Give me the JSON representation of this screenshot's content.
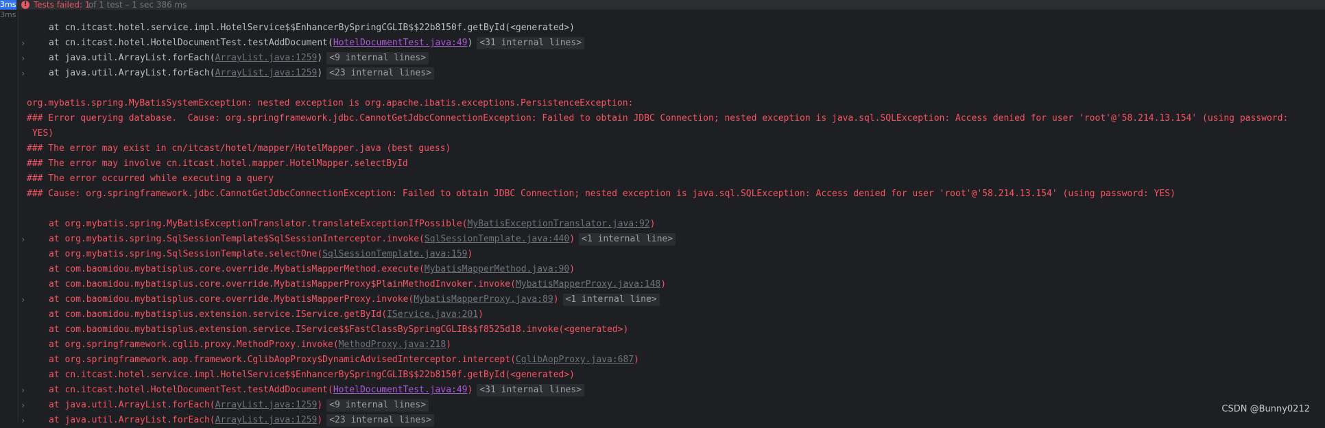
{
  "header": {
    "time_badge": "3ms",
    "status_icon": "error-icon",
    "status_icon_glyph": "!",
    "fail_label": "Tests failed: 1",
    "fail_rest": " of 1 test – 1 sec 386 ms"
  },
  "gutter": {
    "time": "3ms"
  },
  "colors": {
    "error": "#f75464",
    "link": "#a95cd6",
    "dim": "#6f737a",
    "text": "#bcbec4"
  },
  "lines": [
    {
      "frame": true,
      "text": "at cn.itcast.hotel.service.impl.HotelService$$EnhancerBySpringCGLIB$$22b8150f.getById(<generated>)"
    },
    {
      "frame": true,
      "chev": true,
      "text": "at cn.itcast.hotel.HotelDocumentTest.testAddDocument(",
      "link": "HotelDocumentTest.java:49",
      "link_dim": false,
      "close": ")",
      "badge": "<31 internal lines>"
    },
    {
      "frame": true,
      "chev": true,
      "text": "at java.util.ArrayList.forEach(",
      "link": "ArrayList.java:1259",
      "link_dim": true,
      "close": ")",
      "badge": "<9 internal lines>"
    },
    {
      "frame": true,
      "chev": true,
      "text": "at java.util.ArrayList.forEach(",
      "link": "ArrayList.java:1259",
      "link_dim": true,
      "close": ")",
      "badge": "<23 internal lines>"
    },
    {
      "text": ""
    },
    {
      "err": true,
      "text": "org.mybatis.spring.MyBatisSystemException: nested exception is org.apache.ibatis.exceptions.PersistenceException:"
    },
    {
      "err": true,
      "text": "### Error querying database.  Cause: org.springframework.jdbc.CannotGetJdbcConnectionException: Failed to obtain JDBC Connection; nested exception is java.sql.SQLException: Access denied for user 'root'@'58.214.13.154' (using password:"
    },
    {
      "err": true,
      "text": " YES)"
    },
    {
      "err": true,
      "text": "### The error may exist in cn/itcast/hotel/mapper/HotelMapper.java (best guess)"
    },
    {
      "err": true,
      "text": "### The error may involve cn.itcast.hotel.mapper.HotelMapper.selectById"
    },
    {
      "err": true,
      "text": "### The error occurred while executing a query"
    },
    {
      "err": true,
      "text": "### Cause: org.springframework.jdbc.CannotGetJdbcConnectionException: Failed to obtain JDBC Connection; nested exception is java.sql.SQLException: Access denied for user 'root'@'58.214.13.154' (using password: YES)"
    },
    {
      "text": ""
    },
    {
      "err": true,
      "frame": true,
      "text": "at org.mybatis.spring.MyBatisExceptionTranslator.translateExceptionIfPossible(",
      "link": "MyBatisExceptionTranslator.java:92",
      "link_dim": true,
      "close": ")"
    },
    {
      "err": true,
      "frame": true,
      "chev": true,
      "text": "at org.mybatis.spring.SqlSessionTemplate$SqlSessionInterceptor.invoke(",
      "link": "SqlSessionTemplate.java:440",
      "link_dim": true,
      "close": ")",
      "badge": "<1 internal line>"
    },
    {
      "err": true,
      "frame": true,
      "text": "at org.mybatis.spring.SqlSessionTemplate.selectOne(",
      "link": "SqlSessionTemplate.java:159",
      "link_dim": true,
      "close": ")"
    },
    {
      "err": true,
      "frame": true,
      "text": "at com.baomidou.mybatisplus.core.override.MybatisMapperMethod.execute(",
      "link": "MybatisMapperMethod.java:90",
      "link_dim": true,
      "close": ")"
    },
    {
      "err": true,
      "frame": true,
      "text": "at com.baomidou.mybatisplus.core.override.MybatisMapperProxy$PlainMethodInvoker.invoke(",
      "link": "MybatisMapperProxy.java:148",
      "link_dim": true,
      "close": ")"
    },
    {
      "err": true,
      "frame": true,
      "chev": true,
      "text": "at com.baomidou.mybatisplus.core.override.MybatisMapperProxy.invoke(",
      "link": "MybatisMapperProxy.java:89",
      "link_dim": true,
      "close": ")",
      "badge": "<1 internal line>"
    },
    {
      "err": true,
      "frame": true,
      "text": "at com.baomidou.mybatisplus.extension.service.IService.getById(",
      "link": "IService.java:201",
      "link_dim": true,
      "close": ")"
    },
    {
      "err": true,
      "frame": true,
      "text": "at com.baomidou.mybatisplus.extension.service.IService$$FastClassBySpringCGLIB$$f8525d18.invoke(<generated>)"
    },
    {
      "err": true,
      "frame": true,
      "text": "at org.springframework.cglib.proxy.MethodProxy.invoke(",
      "link": "MethodProxy.java:218",
      "link_dim": true,
      "close": ")"
    },
    {
      "err": true,
      "frame": true,
      "text": "at org.springframework.aop.framework.CglibAopProxy$DynamicAdvisedInterceptor.intercept(",
      "link": "CglibAopProxy.java:687",
      "link_dim": true,
      "close": ")"
    },
    {
      "err": true,
      "frame": true,
      "text": "at cn.itcast.hotel.service.impl.HotelService$$EnhancerBySpringCGLIB$$22b8150f.getById(<generated>)"
    },
    {
      "err": true,
      "frame": true,
      "chev": true,
      "text": "at cn.itcast.hotel.HotelDocumentTest.testAddDocument(",
      "link": "HotelDocumentTest.java:49",
      "link_dim": false,
      "close": ")",
      "badge": "<31 internal lines>"
    },
    {
      "err": true,
      "frame": true,
      "chev": true,
      "text": "at java.util.ArrayList.forEach(",
      "link": "ArrayList.java:1259",
      "link_dim": true,
      "close": ")",
      "badge": "<9 internal lines>"
    },
    {
      "err": true,
      "frame": true,
      "chev": true,
      "text": "at java.util.ArrayList.forEach(",
      "link": "ArrayList.java:1259",
      "link_dim": true,
      "close": ")",
      "badge": "<23 internal lines>"
    }
  ],
  "watermark": "CSDN @Bunny0212"
}
